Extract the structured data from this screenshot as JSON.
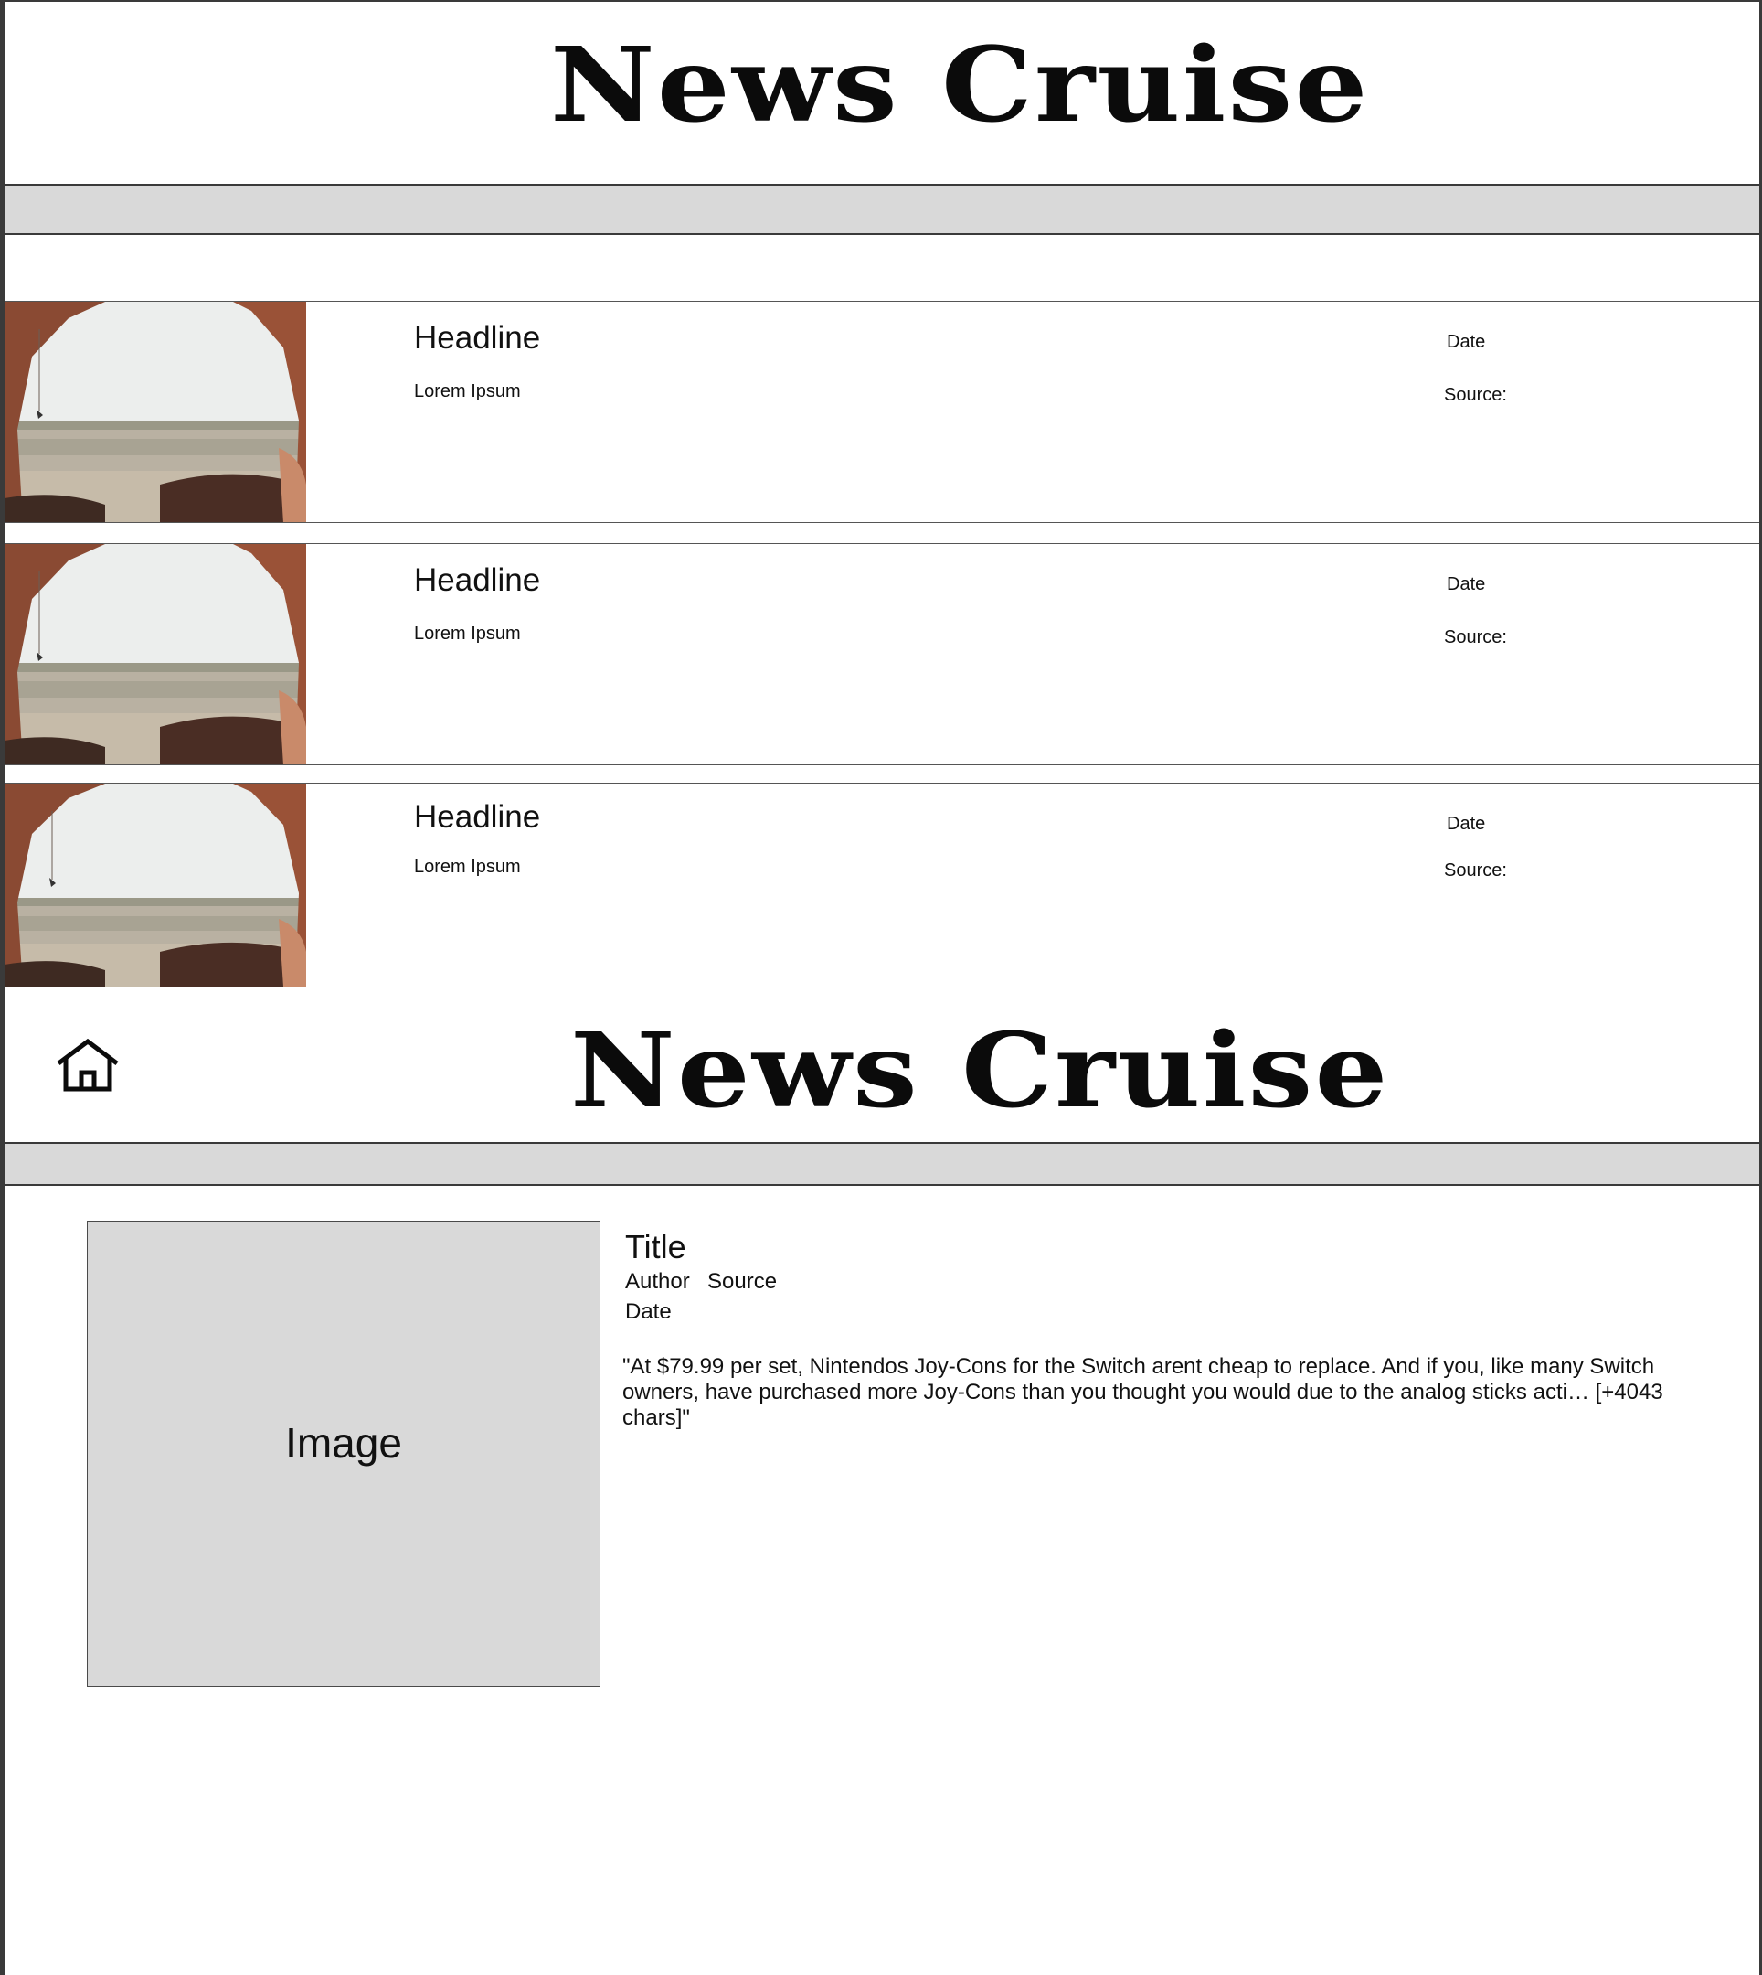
{
  "app": {
    "name": "News Cruise"
  },
  "list_view": {
    "articles": [
      {
        "headline": "Headline",
        "summary": "Lorem Ipsum",
        "date_label": "Date",
        "source_label": "Source:"
      },
      {
        "headline": "Headline",
        "summary": "Lorem Ipsum",
        "date_label": "Date",
        "source_label": "Source:"
      },
      {
        "headline": "Headline",
        "summary": "Lorem Ipsum",
        "date_label": "Date",
        "source_label": "Source:"
      }
    ]
  },
  "detail_view": {
    "home_icon": "home-icon",
    "image_placeholder": "Image",
    "title": "Title",
    "author": "Author",
    "source": "Source",
    "date": "Date",
    "body": "\"At $79.99 per set, Nintendos Joy-Cons for the Switch arent cheap to replace. And if you, like many Switch owners, have purchased more Joy-Cons than you thought you would due to the analog sticks acti… [+4043 chars]\""
  },
  "colors": {
    "nav_bar": "#d9d9d9",
    "image_placeholder": "#d9d9d9",
    "text": "#111111"
  }
}
